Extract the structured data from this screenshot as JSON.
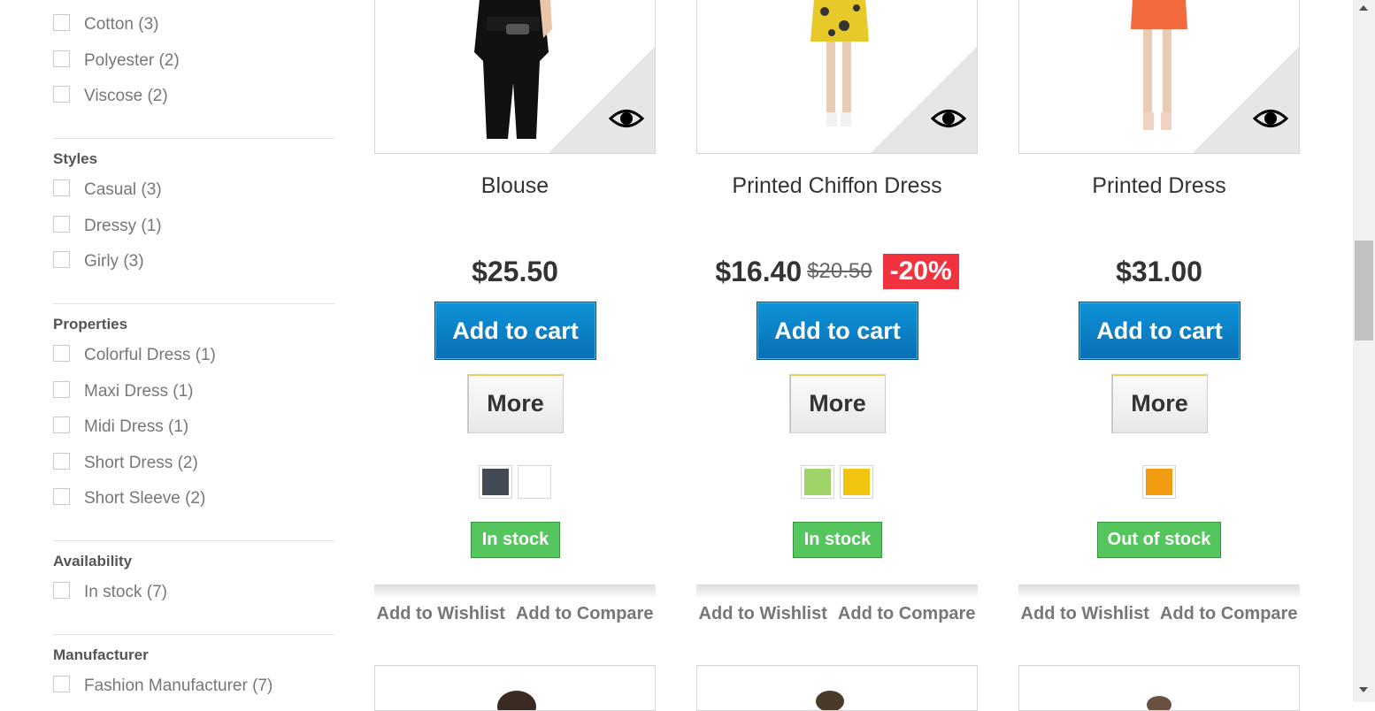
{
  "sidebar": {
    "compositions": {
      "items": [
        {
          "label": "Cotton (3)"
        },
        {
          "label": "Polyester (2)"
        },
        {
          "label": "Viscose (2)"
        }
      ]
    },
    "styles": {
      "title": "Styles",
      "items": [
        {
          "label": "Casual (3)"
        },
        {
          "label": "Dressy (1)"
        },
        {
          "label": "Girly (3)"
        }
      ]
    },
    "properties": {
      "title": "Properties",
      "items": [
        {
          "label": "Colorful Dress (1)"
        },
        {
          "label": "Maxi Dress (1)"
        },
        {
          "label": "Midi Dress (1)"
        },
        {
          "label": "Short Dress (2)"
        },
        {
          "label": "Short Sleeve (2)"
        }
      ]
    },
    "availability": {
      "title": "Availability",
      "items": [
        {
          "label": "In stock (7)"
        }
      ]
    },
    "manufacturer": {
      "title": "Manufacturer",
      "items": [
        {
          "label": "Fashion Manufacturer (7)"
        }
      ]
    }
  },
  "products": [
    {
      "name": "Blouse",
      "price": "$25.50",
      "old_price": "",
      "discount": "",
      "cart_label": "Add to cart",
      "more_label": "More",
      "colors": [
        "#434a54",
        "#ffffff"
      ],
      "stock": "In stock",
      "wishlist_label": "Add to Wishlist",
      "compare_label": "Add to Compare"
    },
    {
      "name": "Printed Chiffon Dress",
      "price": "$16.40",
      "old_price": "$20.50",
      "discount": "-20%",
      "cart_label": "Add to cart",
      "more_label": "More",
      "colors": [
        "#a0d468",
        "#f1c40f"
      ],
      "stock": "In stock",
      "wishlist_label": "Add to Wishlist",
      "compare_label": "Add to Compare"
    },
    {
      "name": "Printed Dress",
      "price": "$31.00",
      "old_price": "",
      "discount": "",
      "cart_label": "Add to cart",
      "more_label": "More",
      "colors": [
        "#f39c11"
      ],
      "stock": "Out of stock",
      "wishlist_label": "Add to Wishlist",
      "compare_label": "Add to Compare"
    }
  ],
  "icons": {
    "quick_view": "eye-icon"
  },
  "colors": {
    "cart_button": "#0a7cc3",
    "stock_badge": "#55c65e",
    "discount_badge": "#f13340"
  }
}
